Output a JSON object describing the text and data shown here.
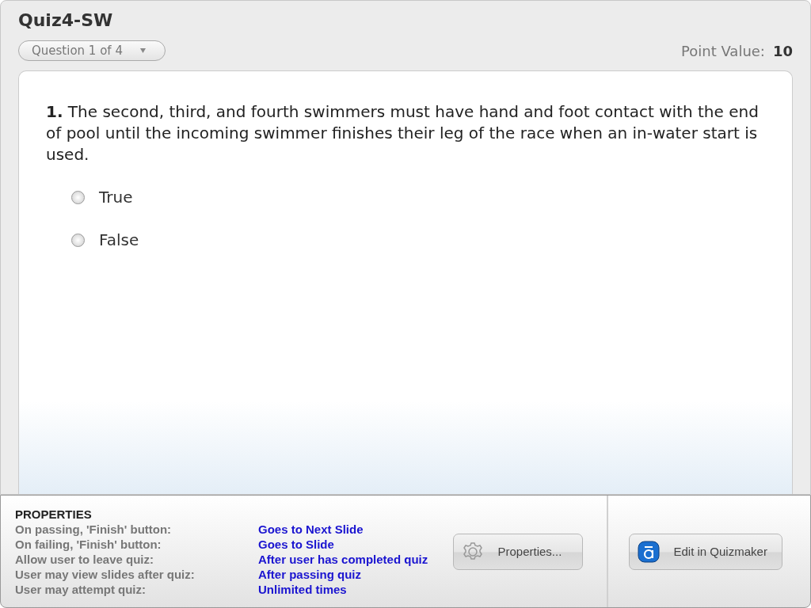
{
  "quiz": {
    "title": "Quiz4-SW",
    "question_selector": "Question 1 of 4",
    "point_value_label": "Point Value:",
    "point_value": "10"
  },
  "question": {
    "text": "**1.** The second, third, and fourth swimmers must have hand and foot contact with the end of pool until the incoming swimmer finishes their leg of the race when an in-water start is used.",
    "options": [
      {
        "label": "True",
        "selected": false
      },
      {
        "label": "False",
        "selected": false
      }
    ]
  },
  "properties": {
    "heading": "PROPERTIES",
    "rows": [
      {
        "label": "On passing, 'Finish' button:",
        "value": "Goes to Next Slide"
      },
      {
        "label": "On failing, 'Finish' button:",
        "value": "Goes to Slide"
      },
      {
        "label": "Allow user to leave quiz:",
        "value": "After user has completed quiz"
      },
      {
        "label": "User may view slides after quiz:",
        "value": "After passing quiz"
      },
      {
        "label": "User may attempt quiz:",
        "value": "Unlimited times"
      }
    ]
  },
  "buttons": {
    "properties": "Properties...",
    "edit": "Edit in Quizmaker"
  }
}
